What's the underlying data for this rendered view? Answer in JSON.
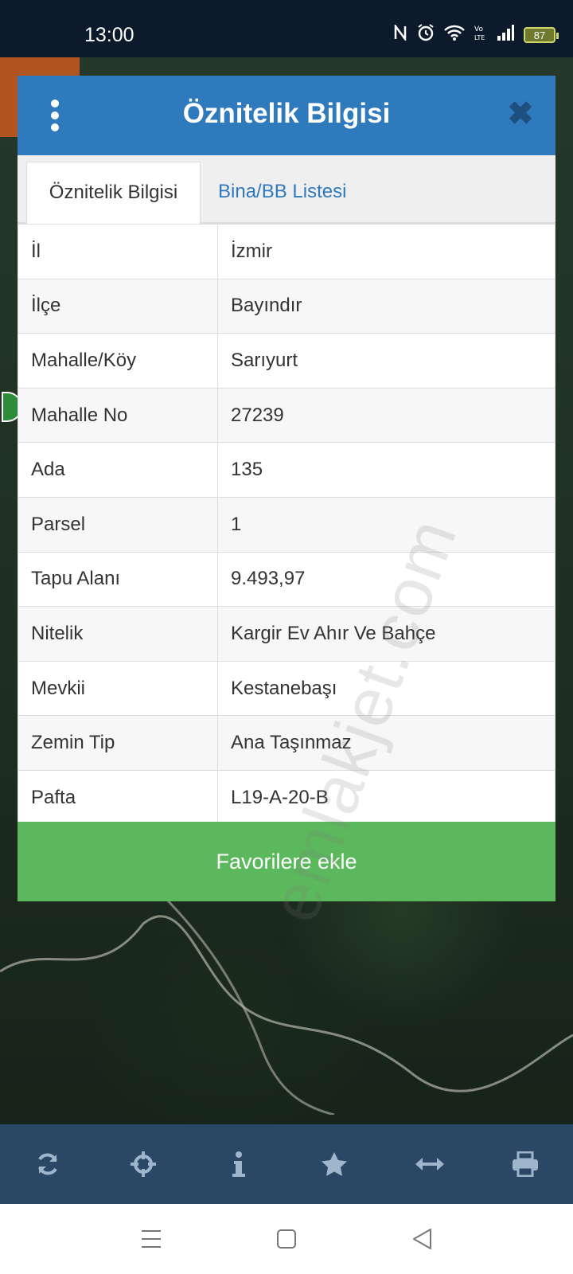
{
  "status_bar": {
    "time": "13:00",
    "battery": "87",
    "icons": [
      "nfc-icon",
      "alarm-icon",
      "wifi-icon",
      "volte-icon",
      "signal-icon"
    ]
  },
  "dialog": {
    "title": "Öznitelik Bilgisi",
    "tabs": [
      {
        "label": "Öznitelik Bilgisi",
        "active": true
      },
      {
        "label": "Bina/BB Listesi",
        "active": false
      }
    ],
    "rows": [
      {
        "key": "İl",
        "value": "İzmir"
      },
      {
        "key": "İlçe",
        "value": "Bayındır"
      },
      {
        "key": "Mahalle/Köy",
        "value": "Sarıyurt"
      },
      {
        "key": "Mahalle No",
        "value": "27239"
      },
      {
        "key": "Ada",
        "value": "135"
      },
      {
        "key": "Parsel",
        "value": "1"
      },
      {
        "key": "Tapu Alanı",
        "value": "9.493,97"
      },
      {
        "key": "Nitelik",
        "value": "Kargir Ev Ahır Ve Bahçe"
      },
      {
        "key": "Mevkii",
        "value": "Kestanebaşı"
      },
      {
        "key": "Zemin Tip",
        "value": "Ana Taşınmaz"
      },
      {
        "key": "Pafta",
        "value": "L19-A-20-B"
      }
    ],
    "favorite_button": "Favorilere ekle",
    "watermark": "emlakjet.com"
  },
  "toolbar": {
    "icons": [
      "refresh-icon",
      "crosshair-icon",
      "info-icon",
      "star-icon",
      "measure-icon",
      "print-icon"
    ]
  },
  "colors": {
    "header": "#2f79bd",
    "button": "#5cb85c",
    "toolbar": "#2a4766"
  }
}
